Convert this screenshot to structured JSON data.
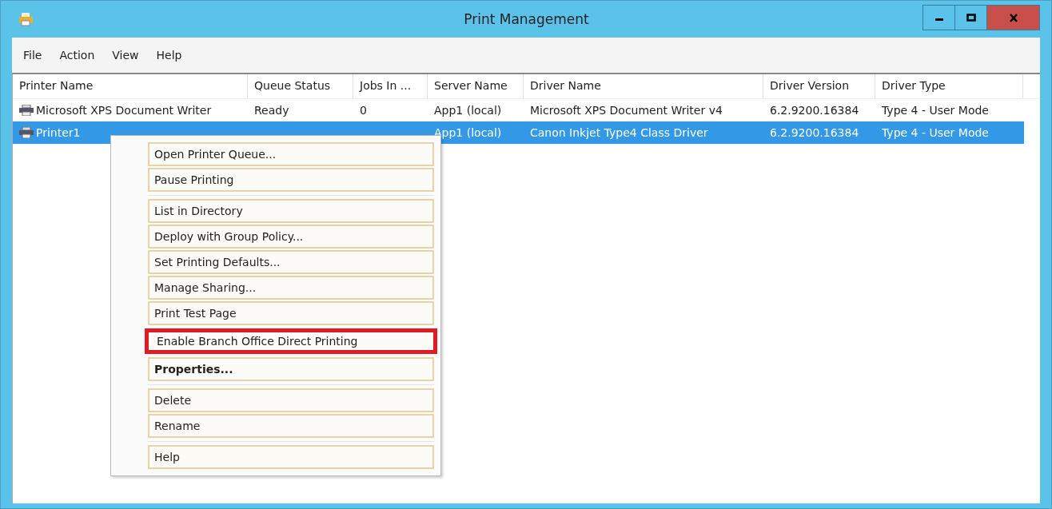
{
  "window": {
    "title": "Print Management"
  },
  "menu_bar": [
    "File",
    "Action",
    "View",
    "Help"
  ],
  "table": {
    "columns": [
      "Printer Name",
      "Queue Status",
      "Jobs In ...",
      "Server Name",
      "Driver Name",
      "Driver Version",
      "Driver Type"
    ],
    "rows": [
      {
        "selected": false,
        "cells": [
          "Microsoft XPS Document Writer",
          "Ready",
          "0",
          "App1 (local)",
          "Microsoft XPS Document Writer v4",
          "6.2.9200.16384",
          "Type 4 - User Mode"
        ]
      },
      {
        "selected": true,
        "cells": [
          "Printer1",
          "",
          "",
          "App1 (local)",
          "Canon Inkjet Type4 Class Driver",
          "6.2.9200.16384",
          "Type 4 - User Mode"
        ]
      }
    ]
  },
  "context_menu": {
    "groups": [
      [
        {
          "label": "Open Printer Queue...",
          "highlighted": false,
          "default": false
        },
        {
          "label": "Pause Printing",
          "highlighted": false,
          "default": false
        }
      ],
      [
        {
          "label": "List in Directory",
          "highlighted": false,
          "default": false
        },
        {
          "label": "Deploy with Group Policy...",
          "highlighted": false,
          "default": false
        },
        {
          "label": "Set Printing Defaults...",
          "highlighted": false,
          "default": false
        },
        {
          "label": "Manage Sharing...",
          "highlighted": false,
          "default": false
        },
        {
          "label": "Print Test Page",
          "highlighted": false,
          "default": false
        },
        {
          "label": "Enable Branch Office Direct Printing",
          "highlighted": true,
          "default": false
        },
        {
          "label": "Properties...",
          "highlighted": false,
          "default": true
        }
      ],
      [
        {
          "label": "Delete",
          "highlighted": false,
          "default": false
        },
        {
          "label": "Rename",
          "highlighted": false,
          "default": false
        }
      ],
      [
        {
          "label": "Help",
          "highlighted": false,
          "default": false
        }
      ]
    ]
  }
}
